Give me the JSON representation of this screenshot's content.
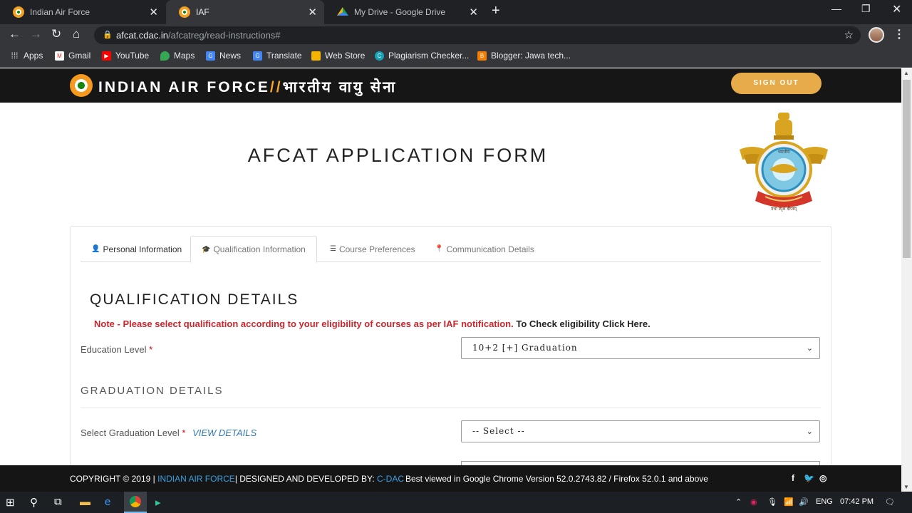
{
  "browser": {
    "tabs": [
      {
        "title": "Indian Air Force",
        "icon": "iaf-roundel-icon"
      },
      {
        "title": "IAF",
        "icon": "iaf-roundel-icon"
      },
      {
        "title": "My Drive - Google Drive",
        "icon": "google-drive-icon"
      }
    ],
    "active_tab": 1,
    "new_tab_label": "+",
    "url_host": "afcat.cdac.in",
    "url_path": "/afcatreg/read-instructions#",
    "bookmarks": [
      "Apps",
      "Gmail",
      "YouTube",
      "Maps",
      "News",
      "Translate",
      "Web Store",
      "Plagiarism Checker...",
      "Blogger: Jawa tech..."
    ]
  },
  "site": {
    "brand_en": "INDIAN AIR FORCE",
    "brand_sep1": "//",
    "brand_sep2": "//",
    "brand_hi": "भारतीय वायु सेना",
    "signout_label": "SIGN OUT",
    "form_title": "AFCAT APPLICATION FORM",
    "emblem_motto": "नभः स्पृशं दीप्तम्",
    "accent_color": "#e7ab4a"
  },
  "form_tabs": [
    {
      "label": "Personal Information",
      "icon": "user-icon"
    },
    {
      "label": "Qualification Information",
      "icon": "graduation-cap-icon"
    },
    {
      "label": "Course Preferences",
      "icon": "list-icon"
    },
    {
      "label": "Communication Details",
      "icon": "map-marker-icon"
    }
  ],
  "active_form_tab": 1,
  "qualification": {
    "heading": "QUALIFICATION DETAILS",
    "note_red": "Note - Please select qualification according to your eligibility of courses as per IAF notification.",
    "note_link": "To Check eligibility Click Here.",
    "education_label": "Education Level",
    "required_mark": "*",
    "education_value": "10+2 [+] Graduation"
  },
  "graduation": {
    "heading": "GRADUATION DETAILS",
    "level_label": "Select Graduation Level",
    "view_details": "VIEW DETAILS",
    "level_value": "-- Select --"
  },
  "footer": {
    "copyright": "COPYRIGHT © 2019 |",
    "org": "INDIAN AIR FORCE",
    "designed": "| DESIGNED AND DEVELOPED BY:",
    "dev": "C-DAC",
    "best_viewed": "Best viewed in Google Chrome Version 52.0.2743.82 / Firefox 52.0.1 and above",
    "social": [
      "facebook-icon",
      "twitter-icon",
      "instagram-icon"
    ]
  },
  "taskbar": {
    "language": "ENG",
    "time": "07:42 PM"
  }
}
